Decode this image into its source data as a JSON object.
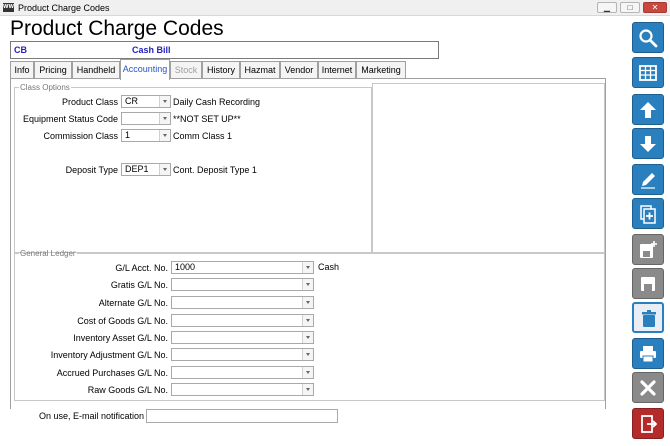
{
  "window": {
    "title": "Product Charge Codes",
    "app_icon_text": "WW",
    "minimize_glyph": "▁",
    "maximize_glyph": "□",
    "close_glyph": "✕"
  },
  "header": {
    "title": "Product Charge Codes",
    "code": "CB",
    "description": "Cash Bill"
  },
  "tabs": [
    {
      "label": "Info",
      "state": "normal"
    },
    {
      "label": "Pricing",
      "state": "normal"
    },
    {
      "label": "Handheld",
      "state": "normal"
    },
    {
      "label": "Accounting",
      "state": "active"
    },
    {
      "label": "Stock",
      "state": "disabled"
    },
    {
      "label": "History",
      "state": "normal"
    },
    {
      "label": "Hazmat",
      "state": "normal"
    },
    {
      "label": "Vendor",
      "state": "normal"
    },
    {
      "label": "Internet",
      "state": "normal"
    },
    {
      "label": "Marketing",
      "state": "normal"
    }
  ],
  "class_options": {
    "legend": "Class Options",
    "fields": [
      {
        "label": "Product Class",
        "value": "CR",
        "description": "Daily Cash Recording"
      },
      {
        "label": "Equipment Status Code",
        "value": "",
        "description": "**NOT SET UP**"
      },
      {
        "label": "Commission Class",
        "value": "1",
        "description": "Comm Class 1"
      },
      {
        "label": "Deposit Type",
        "value": "DEP1",
        "description": "Cont. Deposit Type 1"
      }
    ]
  },
  "general_ledger": {
    "legend": "General Ledger",
    "fields": [
      {
        "label": "G/L Acct. No.",
        "value": "1000",
        "description": "Cash"
      },
      {
        "label": "Gratis G/L No.",
        "value": "",
        "description": ""
      },
      {
        "label": "Alternate G/L No.",
        "value": "",
        "description": ""
      },
      {
        "label": "Cost of Goods G/L No.",
        "value": "",
        "description": ""
      },
      {
        "label": "Inventory Asset G/L No.",
        "value": "",
        "description": ""
      },
      {
        "label": "Inventory Adjustment G/L No.",
        "value": "",
        "description": ""
      },
      {
        "label": "Accrued Purchases G/L No.",
        "value": "",
        "description": ""
      },
      {
        "label": "Raw Goods G/L No.",
        "value": "",
        "description": ""
      }
    ]
  },
  "notification": {
    "label": "On use, E-mail notification",
    "value": ""
  },
  "toolbar": [
    {
      "name": "search",
      "style": "blue"
    },
    {
      "name": "grid-view",
      "style": "blue"
    },
    {
      "name": "previous-record",
      "style": "blue"
    },
    {
      "name": "next-record",
      "style": "blue"
    },
    {
      "name": "edit",
      "style": "blue"
    },
    {
      "name": "copy-new",
      "style": "blue"
    },
    {
      "name": "save-new",
      "style": "gray"
    },
    {
      "name": "save",
      "style": "gray"
    },
    {
      "name": "delete",
      "style": "outline"
    },
    {
      "name": "print",
      "style": "blue"
    },
    {
      "name": "cancel",
      "style": "gray"
    },
    {
      "name": "exit",
      "style": "red"
    }
  ]
}
